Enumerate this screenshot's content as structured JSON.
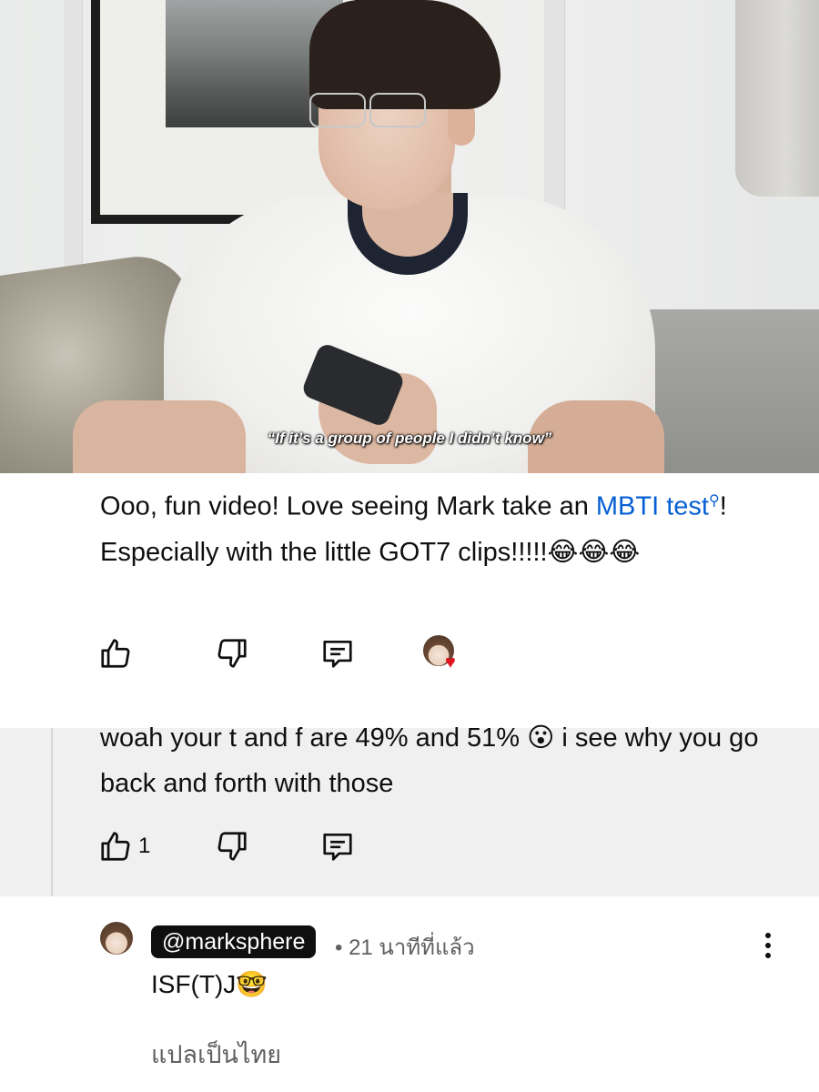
{
  "video": {
    "subtitle": "“If it’s a group of people I didn’t know”"
  },
  "comment": {
    "text_part1": "Ooo, fun video! Love seeing Mark take an ",
    "link_text": "MBTI test",
    "text_part2": "! Especially with the little GOT7 clips!!!!!😂😂😂",
    "actions": {
      "like_icon": "thumbs-up-icon",
      "dislike_icon": "thumbs-down-icon",
      "reply_icon": "reply-comment-icon",
      "creator_heart_icon": "creator-heart-icon"
    }
  },
  "reply1": {
    "text": "woah your t and f are 49% and 51% 😮 i see why you go back and forth with those",
    "like_count": "1"
  },
  "reply2": {
    "handle": "@marksphere",
    "meta": "• 21 นาทีที่แล้ว",
    "body": "ISF(T)J🤓",
    "translate": "แปลเป็นไทย",
    "menu_icon": "more-vertical-icon"
  }
}
